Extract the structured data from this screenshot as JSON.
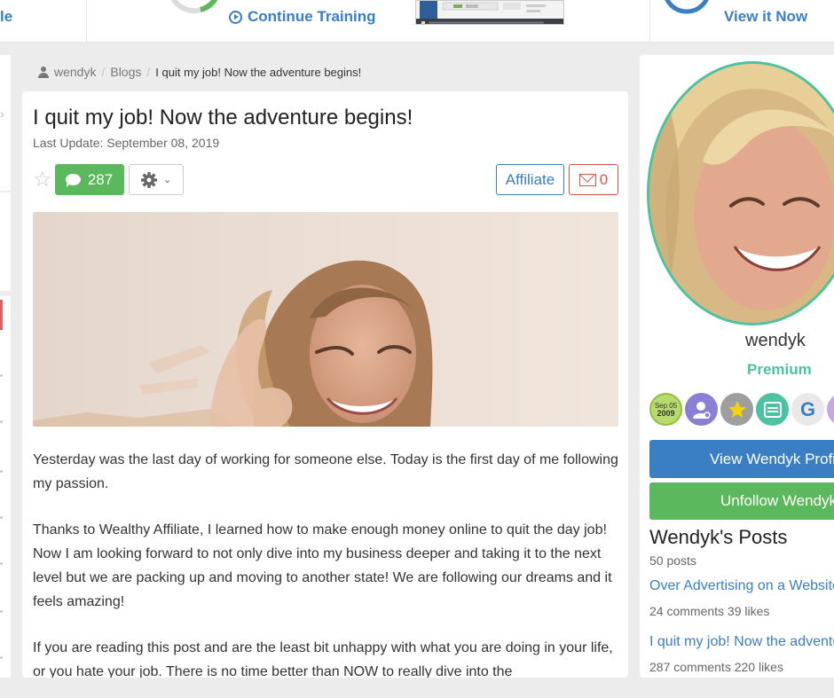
{
  "topbar": {
    "left_text": "le",
    "continue_label": "Continue Training",
    "view_label": "View it Now"
  },
  "breadcrumb": {
    "user": "wendyk",
    "section": "Blogs",
    "current": "I quit my job! Now the adventure begins!"
  },
  "post": {
    "title": "I quit my job! Now the adventure begins!",
    "last_update": "Last Update: September 08, 2019",
    "comments_count": "287",
    "affiliate_label": "Affiliate",
    "mail_count": "0",
    "paragraphs": [
      "Yesterday was the last day of working for someone else. Today is the first day of me following my passion.",
      "Thanks to Wealthy Affiliate, I learned how to make enough money online to quit the day job! Now I am looking forward to not only dive into my business deeper and taking it to the next level but we are packing up and moving to another state! We are following our dreams and it feels amazing!",
      "If you are reading this post and are the least bit unhappy with what you are doing in your life, or you hate your job. There is no time better than NOW to really dive into the"
    ]
  },
  "sidebar": {
    "name": "wendyk",
    "membership": "Premium",
    "badge_date_top": "Sep 05",
    "badge_date_bottom": "2009",
    "badge_g_letter": "G",
    "view_profile_label": "View Wendyk Profile",
    "unfollow_label": "Unfollow Wendyk",
    "posts_title": "Wendyk's Posts",
    "posts_count": "50 posts",
    "posts": [
      {
        "title": "Over Advertising on a Website",
        "meta": "24 comments  39 likes"
      },
      {
        "title": "I quit my job! Now the adventure begins!",
        "meta": "287 comments  220 likes"
      }
    ]
  },
  "colors": {
    "link_blue": "#3a7ec4",
    "success_green": "#5cb85c",
    "danger_red": "#d9534f",
    "premium_teal": "#4cc3a0"
  }
}
